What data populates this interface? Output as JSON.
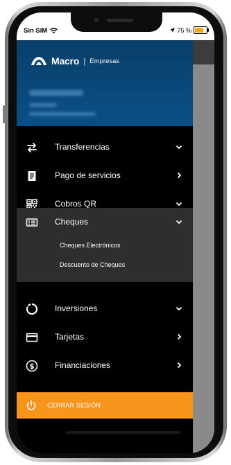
{
  "status_bar": {
    "carrier": "Sin SIM",
    "battery_text": "75 %",
    "battery_level": 0.75,
    "wifi_icon": "wifi-icon",
    "location_icon": "location-arrow-icon"
  },
  "header": {
    "brand": "Macro",
    "separator": "|",
    "segment": "Empresas"
  },
  "menu": {
    "items": [
      {
        "label": "Transferencias",
        "icon": "transfer-arrows-icon",
        "arrow": "chevron-down-icon"
      },
      {
        "label": "Pago de servicios",
        "icon": "receipt-icon",
        "arrow": "chevron-right-icon"
      },
      {
        "label": "Cobros QR",
        "icon": "qr-code-icon",
        "arrow": "chevron-down-icon"
      },
      {
        "label": "Cheques",
        "icon": "cheque-icon",
        "arrow": "chevron-down-icon"
      },
      {
        "label": "Inversiones",
        "icon": "pie-chart-icon",
        "arrow": "chevron-down-icon"
      },
      {
        "label": "Tarjetas",
        "icon": "credit-card-icon",
        "arrow": "chevron-right-icon"
      },
      {
        "label": "Financiaciones",
        "icon": "dollar-circle-icon",
        "arrow": "chevron-right-icon"
      }
    ],
    "cheques_submenu": [
      {
        "label": "Cheques Electrónicos"
      },
      {
        "label": "Descuento de Cheques"
      }
    ]
  },
  "logout": {
    "label": "CERRAR SESIÓN",
    "icon": "power-icon"
  },
  "colors": {
    "header_blue": "#0b4f86",
    "accent_orange": "#f7951d",
    "menu_black": "#000000",
    "selected_gray": "#2e2e2e",
    "battery_yellow": "#f5a800"
  }
}
